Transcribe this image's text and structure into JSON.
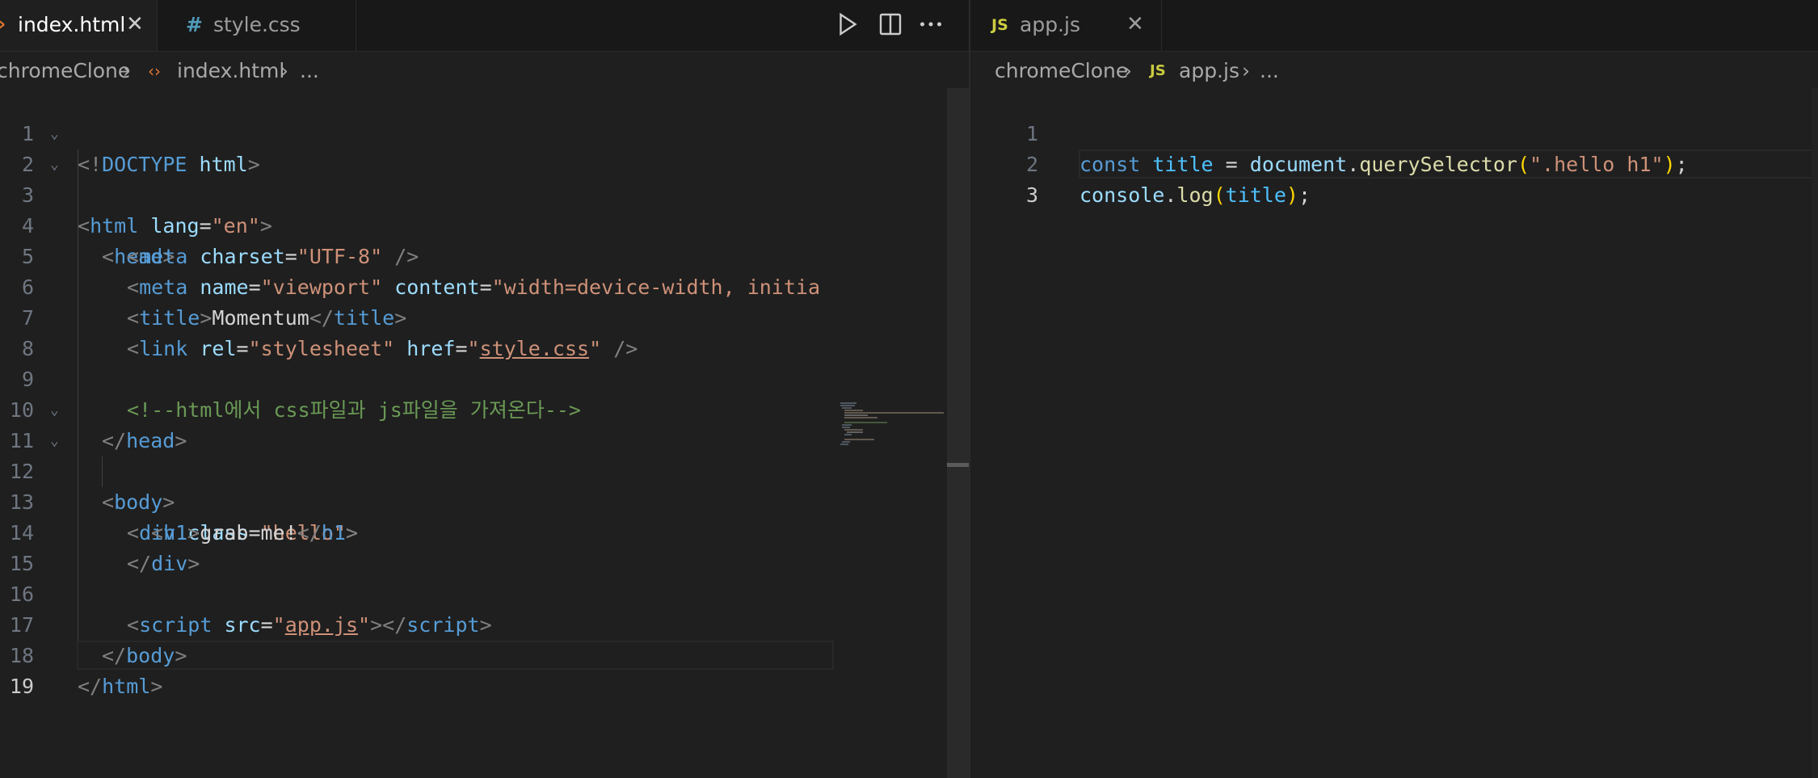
{
  "left_editor": {
    "tabs": [
      {
        "label": "index.html",
        "icon": "html-chevron-icon",
        "active": true
      },
      {
        "label": "style.css",
        "icon": "#",
        "active": false
      }
    ],
    "breadcrumb": {
      "folder": "chromeClone",
      "file_icon": "‹›",
      "file": "index.html",
      "tail": "..."
    },
    "line_numbers": [
      "1",
      "2",
      "3",
      "4",
      "5",
      "6",
      "7",
      "8",
      "9",
      "10",
      "11",
      "12",
      "13",
      "14",
      "15",
      "16",
      "17",
      "18",
      "19"
    ],
    "current_line": "19"
  },
  "right_editor": {
    "tabs": [
      {
        "label": "app.js",
        "icon": "JS",
        "active": false
      }
    ],
    "breadcrumb": {
      "folder": "chromeClone",
      "file_icon": "JS",
      "file": "app.js",
      "tail": "..."
    },
    "line_numbers": [
      "1",
      "2",
      "3"
    ],
    "current_line": "3"
  },
  "colors": {
    "editor_bg": "#1f1f1f",
    "tabbar_bg": "#181818",
    "html_icon": "#e37933",
    "css_icon": "#519aba",
    "js_icon": "#cbcb41"
  },
  "icons": {
    "run": "run-icon",
    "split": "split-editor-icon",
    "more": "more-actions-icon",
    "close": "close-icon"
  }
}
